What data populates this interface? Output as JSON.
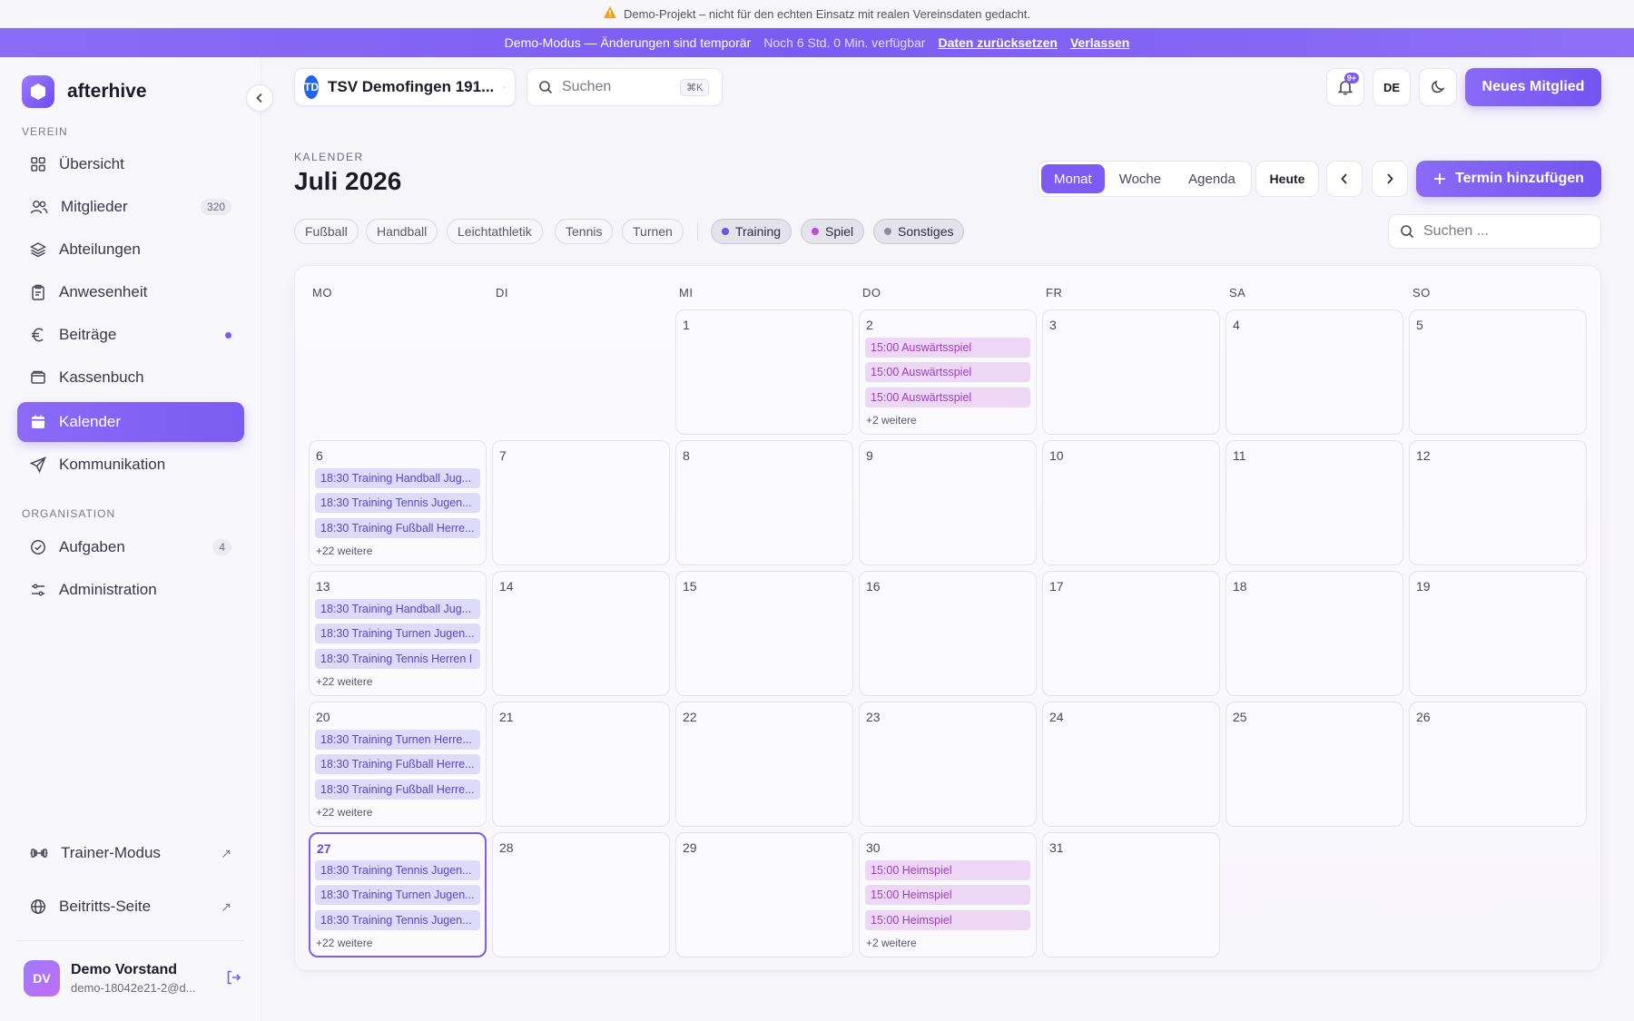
{
  "banner": {
    "warning": "Demo-Projekt – nicht für den echten Einsatz mit realen Vereinsdaten gedacht."
  },
  "demo": {
    "mode": "Demo-Modus — Änderungen sind temporär",
    "remaining": "Noch 6 Std. 0 Min. verfügbar",
    "reset": "Daten zurücksetzen",
    "leave": "Verlassen"
  },
  "brand": {
    "name": "afterhive"
  },
  "sidebar": {
    "section_verein": "VEREIN",
    "section_org": "ORGANISATION",
    "items": {
      "overview": "Übersicht",
      "members": "Mitglieder",
      "members_count": "320",
      "departments": "Abteilungen",
      "attendance": "Anwesenheit",
      "fees": "Beiträge",
      "cashbook": "Kassenbuch",
      "calendar": "Kalender",
      "communication": "Kommunikation",
      "tasks": "Aufgaben",
      "tasks_count": "4",
      "admin": "Administration",
      "trainer": "Trainer-Modus",
      "signup": "Beitritts-Seite"
    },
    "user": {
      "initials": "DV",
      "name": "Demo Vorstand",
      "email": "demo-18042e21-2@d..."
    }
  },
  "header": {
    "club_initials": "TD",
    "club_name": "TSV Demofingen 191...",
    "search_placeholder": "Suchen",
    "search_shortcut": "⌘K",
    "notif_badge": "9+",
    "lang": "DE",
    "new_member": "Neues Mitglied"
  },
  "calendar": {
    "eyebrow": "KALENDER",
    "title": "Juli 2026",
    "views": {
      "month": "Monat",
      "week": "Woche",
      "agenda": "Agenda"
    },
    "today": "Heute",
    "add": "Termin hinzufügen",
    "search_placeholder": "Suchen ...",
    "filters": [
      "Fußball",
      "Handball",
      "Leichtathletik",
      "Tennis",
      "Turnen"
    ],
    "types": {
      "training": "Training",
      "spiel": "Spiel",
      "other": "Sonstiges"
    },
    "colors": {
      "training": "#6b52e0",
      "spiel": "#b64fd6",
      "other": "#8e8b9b",
      "accent": "#7c5cf2"
    },
    "weekdays": [
      "MO",
      "DI",
      "MI",
      "DO",
      "FR",
      "SA",
      "SO"
    ],
    "days": {
      "d1": "1",
      "d2": "2",
      "d3": "3",
      "d4": "4",
      "d5": "5",
      "d6": "6",
      "d7": "7",
      "d8": "8",
      "d9": "9",
      "d10": "10",
      "d11": "11",
      "d12": "12",
      "d13": "13",
      "d14": "14",
      "d15": "15",
      "d16": "16",
      "d17": "17",
      "d18": "18",
      "d19": "19",
      "d20": "20",
      "d21": "21",
      "d22": "22",
      "d23": "23",
      "d24": "24",
      "d25": "25",
      "d26": "26",
      "d27": "27",
      "d28": "28",
      "d29": "29",
      "d30": "30",
      "d31": "31"
    },
    "events": {
      "d2": [
        "15:00 Auswärtsspiel",
        "15:00 Auswärtsspiel",
        "15:00 Auswärtsspiel"
      ],
      "d2_more": "+2 weitere",
      "d6": [
        "18:30 Training Handball Jug...",
        "18:30 Training Tennis Jugen...",
        "18:30 Training Fußball Herre..."
      ],
      "d6_more": "+22 weitere",
      "d13": [
        "18:30 Training Handball Jug...",
        "18:30 Training Turnen Jugen...",
        "18:30 Training Tennis Herren I"
      ],
      "d13_more": "+22 weitere",
      "d20": [
        "18:30 Training Turnen Herre...",
        "18:30 Training Fußball Herre...",
        "18:30 Training Fußball Herre..."
      ],
      "d20_more": "+22 weitere",
      "d27": [
        "18:30 Training Tennis Jugen...",
        "18:30 Training Turnen Jugen...",
        "18:30 Training Tennis Jugen..."
      ],
      "d27_more": "+22 weitere",
      "d30": [
        "15:00 Heimspiel",
        "15:00 Heimspiel",
        "15:00 Heimspiel"
      ],
      "d30_more": "+2 weitere"
    }
  }
}
